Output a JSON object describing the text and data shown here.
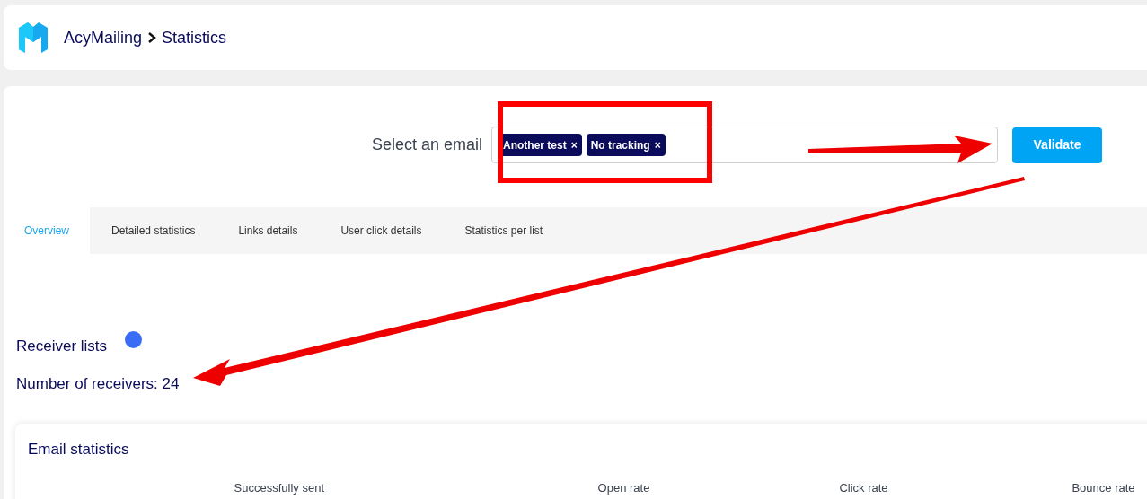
{
  "breadcrumb": {
    "app": "AcyMailing",
    "page": "Statistics"
  },
  "email_select": {
    "label": "Select an email",
    "tags": [
      {
        "label": "Another test",
        "remove": "×"
      },
      {
        "label": "No tracking",
        "remove": "×"
      }
    ],
    "button": "Validate"
  },
  "tabs": [
    {
      "label": "Overview",
      "selected": true
    },
    {
      "label": "Detailed statistics",
      "selected": false
    },
    {
      "label": "Links details",
      "selected": false
    },
    {
      "label": "User click details",
      "selected": false
    },
    {
      "label": "Statistics per list",
      "selected": false
    }
  ],
  "receiver_lists": {
    "title": "Receiver lists",
    "color": "#3b6cf6",
    "count_text": "Number of receivers: 24"
  },
  "email_statistics": {
    "title": "Email statistics",
    "columns": [
      "Successfully sent",
      "Open rate",
      "Click rate",
      "Bounce rate"
    ]
  }
}
